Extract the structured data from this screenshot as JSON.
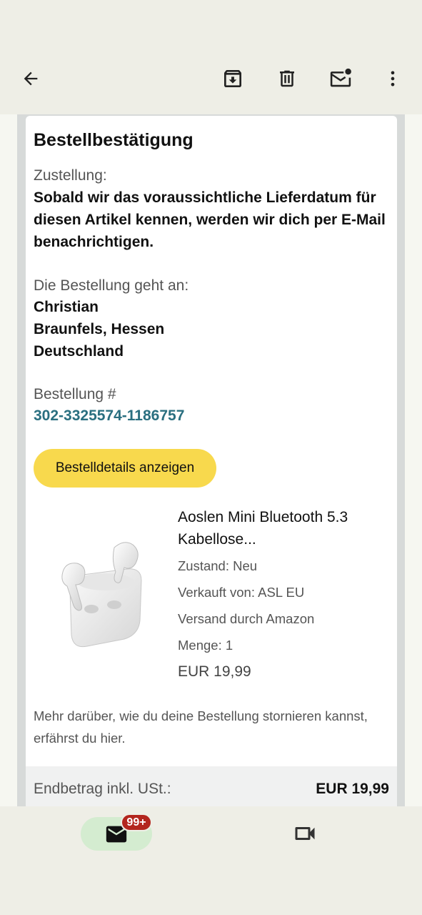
{
  "toolbar": {
    "icons": [
      "back-arrow-icon",
      "archive-icon",
      "delete-icon",
      "mark-unread-icon",
      "more-vert-icon"
    ]
  },
  "email": {
    "title": "Bestellbestätigung",
    "delivery_label": "Zustellung:",
    "delivery_text": "Sobald wir das voraussichtliche Lieferdatum für diesen Artikel kennen, werden wir dich per E-Mail benachrichtigen.",
    "ship_to_label": "Die Bestellung geht an:",
    "ship_to": [
      "Christian",
      "Braunfels, Hessen",
      "Deutschland"
    ],
    "order_label": "Bestellung #",
    "order_number": "302-3325574-1186757",
    "details_button": "Bestelldetails anzeigen",
    "product": {
      "name": "Aoslen Mini Bluetooth 5.3 Kabellose...",
      "condition": "Zustand: Neu",
      "seller": "Verkauft von: ASL EU",
      "shipping": "Versand durch Amazon",
      "quantity": "Menge: 1",
      "price": "EUR 19,99"
    },
    "cancel_note": "Mehr darüber, wie du deine Bestellung stornieren kannst, erfährst du hier.",
    "total_label": "Endbetrag inkl. USt.:",
    "total_value": "EUR 19,99"
  },
  "bottom_nav": {
    "mail_badge": "99+",
    "icons": [
      "mail-icon",
      "video-camera-icon"
    ]
  },
  "colors": {
    "accent_button": "#f8d94d",
    "order_link": "#2a6f80",
    "badge": "#b3261e",
    "mail_pill": "#d4ecd0"
  }
}
